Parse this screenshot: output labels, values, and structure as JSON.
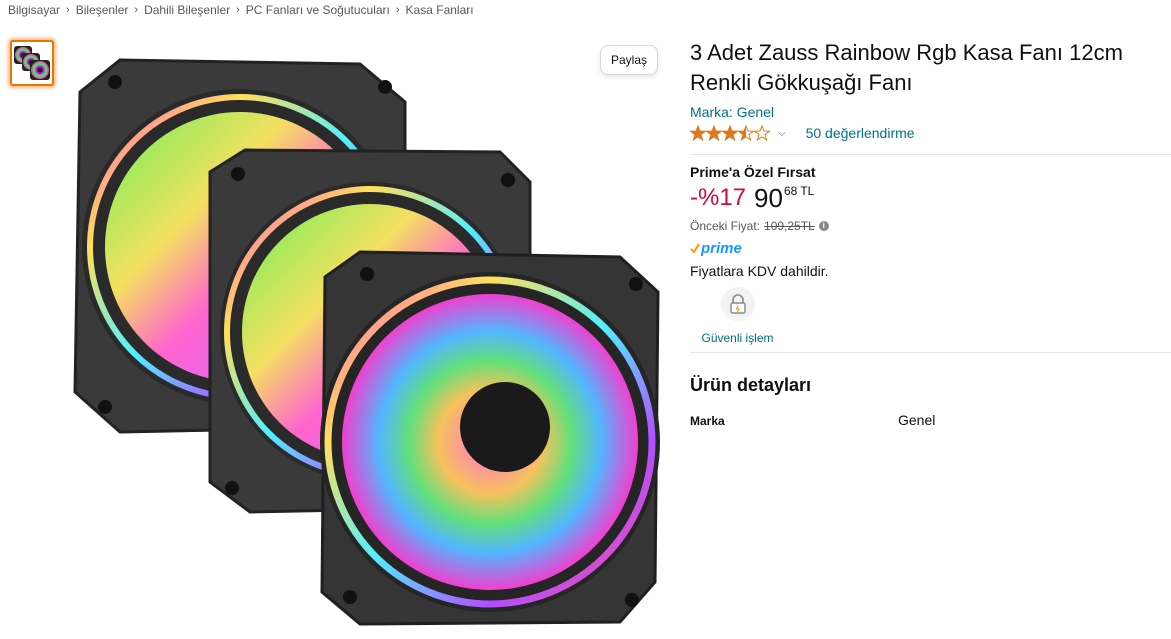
{
  "breadcrumb": [
    "Bilgisayar",
    "Bileşenler",
    "Dahili Bileşenler",
    "PC Fanları ve Soğutucuları",
    "Kasa Fanları"
  ],
  "share_label": "Paylaş",
  "product": {
    "title": "3 Adet Zauss Rainbow Rgb Kasa Fanı 12cm Renkli Gökkuşağı Fanı",
    "brand_link": "Marka: Genel",
    "rating_value": 3.5,
    "rating_count": "50 değerlendirme",
    "deal_label": "Prime'a Özel Fırsat",
    "discount": "-%17",
    "price_whole": "90",
    "price_fraction": "68",
    "currency": "TL",
    "previous_price_label": "Önceki Fiyat:",
    "previous_price": "109,25TL",
    "prime_label": "prime",
    "vat_note": "Fiyatlara KDV dahildir.",
    "secure_label": "Güvenli işlem"
  },
  "details": {
    "title": "Ürün detayları",
    "rows": [
      {
        "key": "Marka",
        "value": "Genel"
      }
    ]
  },
  "colors": {
    "link": "#007185",
    "discount": "#cc0c39",
    "star": "#de7921",
    "prime": "#1a98ff"
  }
}
